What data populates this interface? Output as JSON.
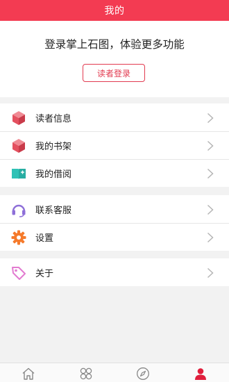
{
  "header": {
    "title": "我的"
  },
  "login": {
    "prompt": "登录掌上石图，体验更多功能",
    "button_label": "读者登录"
  },
  "menu_groups": [
    {
      "items": [
        {
          "label": "读者信息",
          "icon": "cube-icon"
        },
        {
          "label": "我的书架",
          "icon": "cube-icon"
        },
        {
          "label": "我的借阅",
          "icon": "book-plus-icon"
        }
      ]
    },
    {
      "items": [
        {
          "label": "联系客服",
          "icon": "headset-icon"
        },
        {
          "label": "设置",
          "icon": "gear-icon"
        }
      ]
    },
    {
      "items": [
        {
          "label": "关于",
          "icon": "tag-icon"
        }
      ]
    }
  ],
  "tabbar": {
    "tabs": [
      {
        "name": "home",
        "icon": "home-icon",
        "active": false
      },
      {
        "name": "apps",
        "icon": "apps-icon",
        "active": false
      },
      {
        "name": "discover",
        "icon": "compass-icon",
        "active": false
      },
      {
        "name": "profile",
        "icon": "user-icon",
        "active": true
      }
    ]
  },
  "colors": {
    "brand": "#f33b52",
    "cube": "#e85c6a",
    "book": "#2fc2b6",
    "headset": "#8e6fd8",
    "gear": "#f57a2b",
    "tag": "#e27bd0",
    "tab_inactive": "#888888"
  }
}
